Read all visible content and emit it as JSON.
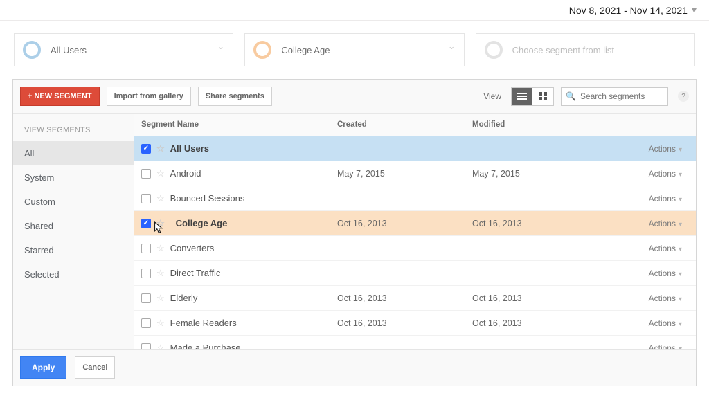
{
  "date_range": "Nov 8, 2021 - Nov 14, 2021",
  "chips": {
    "blue": "All Users",
    "orange": "College Age",
    "gray": "Choose segment from list"
  },
  "toolbar": {
    "new_segment": "+ NEW SEGMENT",
    "import": "Import from gallery",
    "share": "Share segments",
    "view_label": "View",
    "search_placeholder": "Search segments"
  },
  "sidebar": {
    "title": "VIEW SEGMENTS",
    "items": [
      "All",
      "System",
      "Custom",
      "Shared",
      "Starred",
      "Selected"
    ]
  },
  "table": {
    "headers": {
      "name": "Segment Name",
      "created": "Created",
      "modified": "Modified"
    },
    "actions_label": "Actions",
    "rows": [
      {
        "name": "All Users",
        "created": "",
        "modified": "",
        "checked": true,
        "highlight": "blue"
      },
      {
        "name": "Android",
        "created": "May 7, 2015",
        "modified": "May 7, 2015",
        "checked": false,
        "highlight": ""
      },
      {
        "name": "Bounced Sessions",
        "created": "",
        "modified": "",
        "checked": false,
        "highlight": ""
      },
      {
        "name": "College Age",
        "created": "Oct 16, 2013",
        "modified": "Oct 16, 2013",
        "checked": true,
        "highlight": "orange"
      },
      {
        "name": "Converters",
        "created": "",
        "modified": "",
        "checked": false,
        "highlight": ""
      },
      {
        "name": "Direct Traffic",
        "created": "",
        "modified": "",
        "checked": false,
        "highlight": ""
      },
      {
        "name": "Elderly",
        "created": "Oct 16, 2013",
        "modified": "Oct 16, 2013",
        "checked": false,
        "highlight": ""
      },
      {
        "name": "Female Readers",
        "created": "Oct 16, 2013",
        "modified": "Oct 16, 2013",
        "checked": false,
        "highlight": ""
      },
      {
        "name": "Made a Purchase",
        "created": "",
        "modified": "",
        "checked": false,
        "highlight": ""
      }
    ]
  },
  "footer": {
    "apply": "Apply",
    "cancel": "Cancel"
  }
}
